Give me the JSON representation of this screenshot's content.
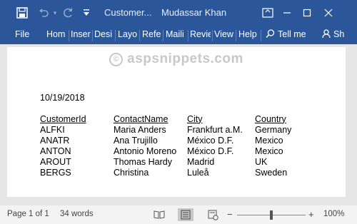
{
  "titlebar": {
    "doc_title": "Customer...",
    "user_name": "Mudassar Khan"
  },
  "ribbon": {
    "tabs": [
      "File",
      "Hom",
      "Inser",
      "Desi",
      "Layo",
      "Refe",
      "Maili",
      "Revie",
      "View",
      "Help"
    ],
    "tell_me": "Tell me",
    "share": "Sh"
  },
  "document": {
    "watermark": "aspsnippets.com",
    "watermark_mark": "©",
    "date": "10/19/2018",
    "table": {
      "headers": [
        "CustomerId",
        "ContactName",
        "City",
        "Country"
      ],
      "rows": [
        [
          "ALFKI",
          "Maria Anders",
          "Frankfurt a.M.",
          "Germany"
        ],
        [
          "ANATR",
          "Ana Trujillo",
          "México D.F.",
          "Mexico"
        ],
        [
          "ANTON",
          "Antonio Moreno",
          "México D.F.",
          "Mexico"
        ],
        [
          "AROUT",
          "Thomas Hardy",
          "Madrid",
          "UK"
        ],
        [
          "BERGS",
          "Christina",
          "Luleå",
          "Sweden"
        ]
      ]
    }
  },
  "statusbar": {
    "page_info": "Page 1 of 1",
    "word_count": "34 words",
    "zoom_minus": "−",
    "zoom_plus": "+",
    "zoom_level": "100%",
    "zoom_fraction": 0.5
  },
  "colors": {
    "ribbon": "#2b579a",
    "statusbar": "#f3f3f3",
    "canvas": "#e6e6e6"
  },
  "icons": {
    "titlebar": [
      "save-icon",
      "undo-icon",
      "redo-icon",
      "customize-qat-icon",
      "ribbon-display-icon",
      "minimize-icon",
      "restore-icon",
      "close-icon"
    ],
    "ribbon": [
      "lightbulb-search-icon",
      "share-person-icon"
    ],
    "statusbar": [
      "read-mode-icon",
      "print-layout-icon",
      "web-layout-icon"
    ]
  }
}
